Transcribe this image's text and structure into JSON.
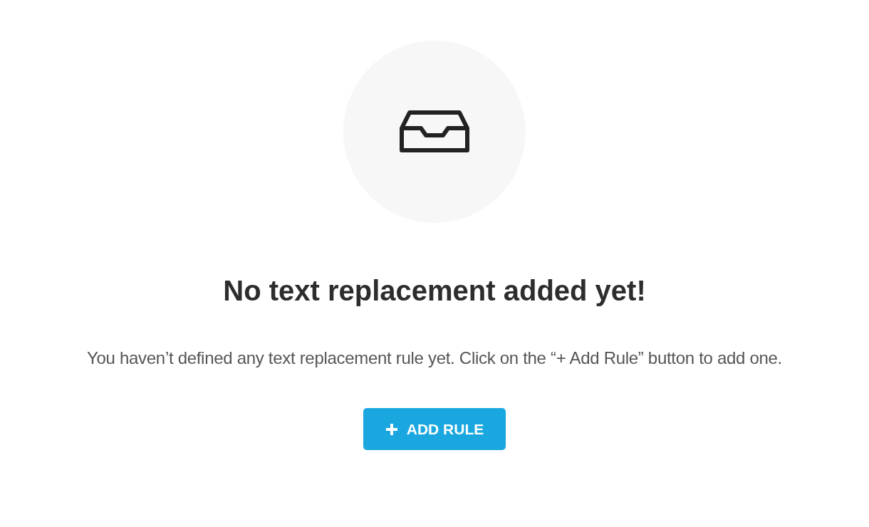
{
  "empty_state": {
    "title": "No text replacement added yet!",
    "message": "You haven’t defined any text replacement rule yet. Click on the “+ Add Rule” button to add one.",
    "button": {
      "label": "ADD RULE"
    }
  }
}
